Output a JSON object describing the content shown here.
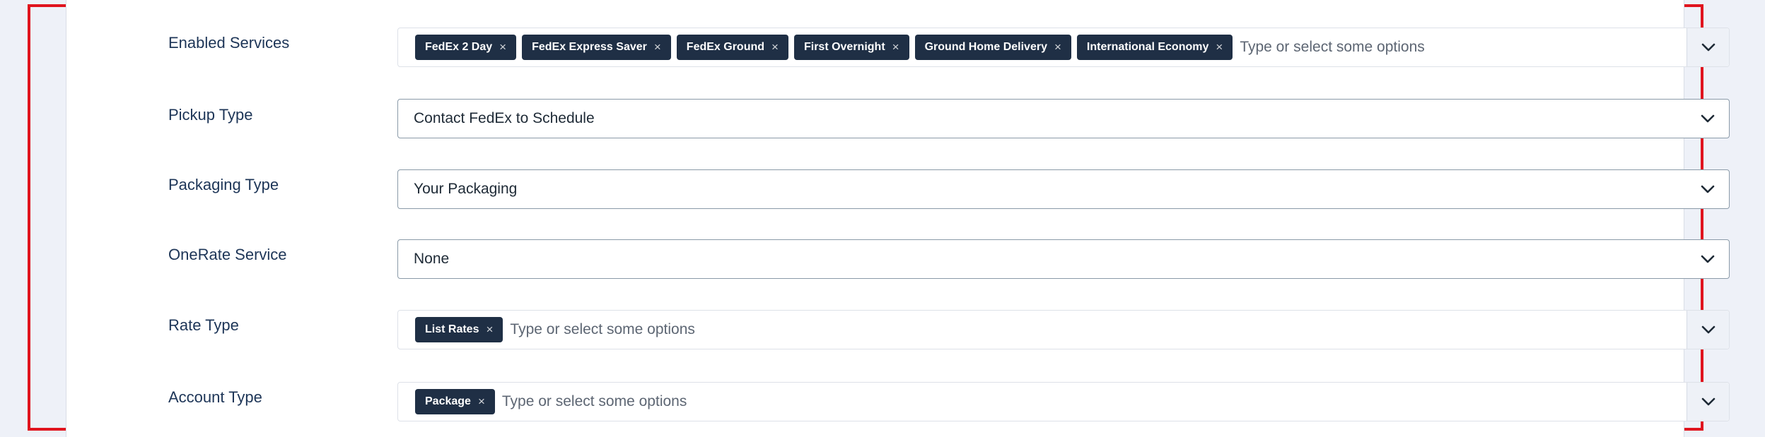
{
  "rows": {
    "enabled_services": {
      "label": "Enabled Services",
      "chips": [
        "FedEx 2 Day",
        "FedEx Express Saver",
        "FedEx Ground",
        "First Overnight",
        "Ground Home Delivery",
        "International Economy"
      ],
      "placeholder": "Type or select some options"
    },
    "pickup_type": {
      "label": "Pickup Type",
      "value": "Contact FedEx to Schedule"
    },
    "packaging_type": {
      "label": "Packaging Type",
      "value": "Your Packaging"
    },
    "onerate_service": {
      "label": "OneRate Service",
      "value": "None"
    },
    "rate_type": {
      "label": "Rate Type",
      "chips": [
        "List Rates"
      ],
      "placeholder": "Type or select some options"
    },
    "account_type": {
      "label": "Account Type",
      "chips": [
        "Package"
      ],
      "placeholder": "Type or select some options"
    }
  },
  "chip_remove_glyph": "×",
  "icons": {
    "dropdown": "chevron-down-icon"
  },
  "colors": {
    "frame": "#e0141e",
    "chip_bg": "#1f2f45",
    "label": "#1d3557"
  }
}
